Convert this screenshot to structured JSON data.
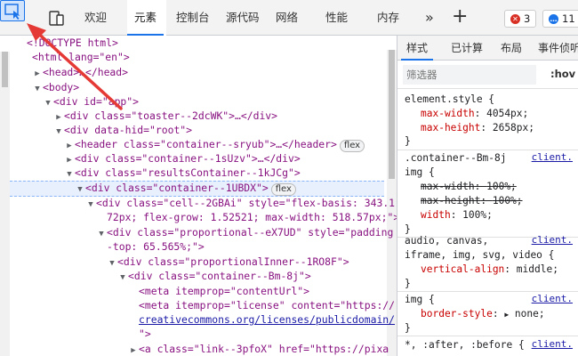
{
  "toolbar": {
    "tabs": [
      "欢迎",
      "元素",
      "控制台",
      "源代码",
      "网络",
      "性能",
      "内存"
    ],
    "active_tab": "元素",
    "more_symbol": "»",
    "add_symbol": "+",
    "error_count": "3",
    "message_count": "11"
  },
  "dom": {
    "lines": [
      {
        "t": "<!DOCTYPE html>"
      },
      {
        "t": "<html lang=\"en\">"
      },
      {
        "t": "<head>…</head>"
      },
      {
        "t": "<body>"
      },
      {
        "t": "<div id=\"app\">"
      },
      {
        "t": "<div class=\"toaster--2dcWK\">…</div>"
      },
      {
        "t": "<div data-hid=\"root\">"
      },
      {
        "t": "<header class=\"container--sryub\">…</header>"
      },
      {
        "t": "<div class=\"container--1sUzv\">…</div>"
      },
      {
        "t": "<div class=\"resultsContainer--1kJCg\">"
      },
      {
        "t": "<div class=\"container--1UBDX\">"
      },
      {
        "t": "<div class=\"cell--2GBAi\" style=\"flex-basis: 343.1"
      },
      {
        "t": "72px; flex-grow: 1.52521; max-width: 518.57px;\">"
      },
      {
        "t": "<div class=\"proportional--eX7UD\" style=\"padding"
      },
      {
        "t": "-top: 65.565%;\">"
      },
      {
        "t": "<div class=\"proportionalInner--1RO8F\">"
      },
      {
        "t": "<div class=\"container--Bm-8j\">"
      },
      {
        "t": "<meta itemprop=\"contentUrl\">"
      },
      {
        "t": "<meta itemprop=\"license\" content=\"https://"
      },
      {
        "t": "creativecommons.org/licenses/publicdomain/"
      },
      {
        "t": "\">"
      },
      {
        "t": "<a class=\"link--3pfoX\" href=\"https://pixa"
      }
    ],
    "flex_label": "flex"
  },
  "styles": {
    "tabs": [
      "样式",
      "已计算",
      "布局",
      "事件侦听"
    ],
    "active_tab": "样式",
    "filter_placeholder": "筛选器",
    "hov_label": ":hov",
    "source_link": "client.",
    "rules": {
      "element_style": {
        "selector": "element.style {",
        "props": [
          [
            "max-width",
            "4054px;"
          ],
          [
            "max-height",
            "2658px;"
          ]
        ],
        "close": "}"
      },
      "container_img": {
        "selector1": ".container--Bm-8j",
        "selector2": "img {",
        "props": [
          [
            "max-width",
            "100%;"
          ],
          [
            "max-height",
            "100%;"
          ],
          [
            "width",
            "100%;"
          ]
        ],
        "close": "}"
      },
      "media_rule": {
        "selector1": "audio, canvas,",
        "selector2": "iframe, img, svg, video {",
        "props": [
          [
            "vertical-align",
            "middle;"
          ]
        ],
        "close": "}"
      },
      "img_rule": {
        "selector": "img {",
        "props": [
          [
            "border-style",
            "none;"
          ]
        ],
        "close": "}"
      },
      "universal": {
        "selector": "*, :after, :before {"
      }
    }
  }
}
